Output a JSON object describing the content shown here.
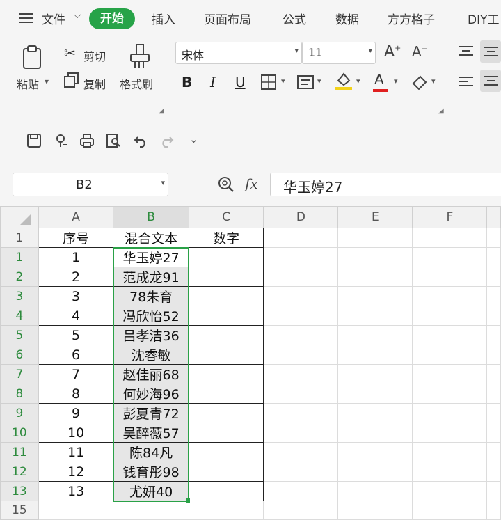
{
  "tabs": {
    "menu_label": "文件",
    "items": [
      "开始",
      "插入",
      "页面布局",
      "公式",
      "数据",
      "方方格子",
      "DIY工"
    ]
  },
  "ribbon": {
    "paste": "粘贴",
    "cut": "剪切",
    "copy": "复制",
    "format_painter": "格式刷",
    "font_name": "宋体",
    "font_size": "11",
    "bold": "B",
    "italic": "I",
    "underline": "U",
    "font_color_letter": "A"
  },
  "formula_bar": {
    "name_box": "B2",
    "fx": "fx",
    "content": "华玉婷27"
  },
  "sheet": {
    "columns": [
      "A",
      "B",
      "C",
      "D",
      "E",
      "F"
    ],
    "headers": [
      "序号",
      "混合文本",
      "数字"
    ],
    "rows": [
      {
        "n": "1",
        "a": "1",
        "b": "华玉婷27"
      },
      {
        "n": "2",
        "a": "2",
        "b": "范成龙91"
      },
      {
        "n": "3",
        "a": "3",
        "b": "78朱育"
      },
      {
        "n": "4",
        "a": "4",
        "b": "冯欣怡52"
      },
      {
        "n": "5",
        "a": "5",
        "b": "吕孝洁36"
      },
      {
        "n": "6",
        "a": "6",
        "b": "沈睿敏"
      },
      {
        "n": "7",
        "a": "7",
        "b": "赵佳丽68"
      },
      {
        "n": "8",
        "a": "8",
        "b": "何妙海96"
      },
      {
        "n": "9",
        "a": "9",
        "b": "彭夏青72"
      },
      {
        "n": "10",
        "a": "10",
        "b": "吴醉薇57"
      },
      {
        "n": "11",
        "a": "11",
        "b": "陈84凡"
      },
      {
        "n": "12",
        "a": "12",
        "b": "钱育彤98"
      },
      {
        "n": "13",
        "a": "13",
        "b": "尤妍40"
      }
    ],
    "header_row_num": "1",
    "last_row_num": "15"
  },
  "colors": {
    "accent": "#27a348",
    "selection": "#2aa147"
  }
}
